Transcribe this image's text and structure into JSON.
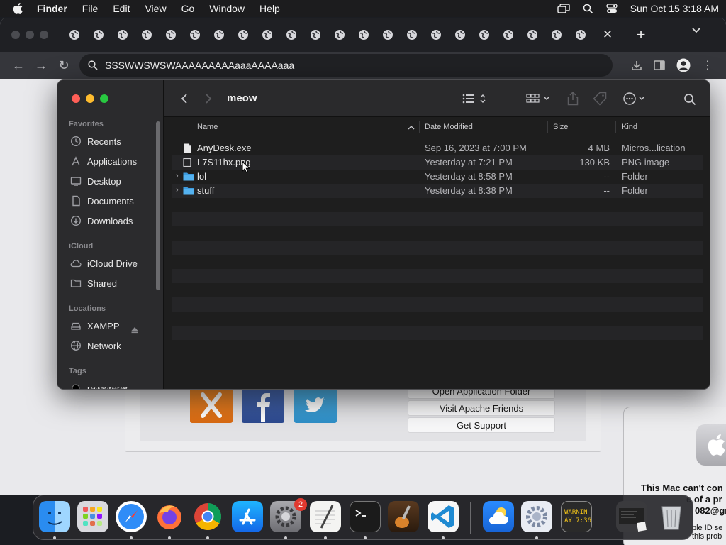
{
  "menubar": {
    "app_name": "Finder",
    "items": [
      "File",
      "Edit",
      "View",
      "Go",
      "Window",
      "Help"
    ],
    "clock": "Sun Oct 15  3:18 AM"
  },
  "browser": {
    "address": "SSSWWSWSWAAAAAAAAAaaaAAAAaaa",
    "tab_count": 22
  },
  "xampp": {
    "buttons": [
      "Open Application Folder",
      "Visit Apache Friends",
      "Get Support"
    ]
  },
  "alert": {
    "line1": "This Mac can't con",
    "line2": "e of a pr",
    "line3": "082@gr",
    "line4": "ple ID se",
    "line5": "this prob"
  },
  "finder": {
    "folder_title": "meow",
    "sidebar": {
      "favorites_label": "Favorites",
      "favorites": [
        {
          "label": "Recents",
          "icon": "clock-icon"
        },
        {
          "label": "Applications",
          "icon": "applications-icon"
        },
        {
          "label": "Desktop",
          "icon": "desktop-icon"
        },
        {
          "label": "Documents",
          "icon": "document-icon"
        },
        {
          "label": "Downloads",
          "icon": "download-icon"
        }
      ],
      "icloud_label": "iCloud",
      "icloud": [
        {
          "label": "iCloud Drive",
          "icon": "cloud-icon"
        },
        {
          "label": "Shared",
          "icon": "shared-folder-icon"
        }
      ],
      "locations_label": "Locations",
      "locations": [
        {
          "label": "XAMPP",
          "icon": "drive-icon"
        },
        {
          "label": "Network",
          "icon": "globe-icon"
        }
      ],
      "tags_label": "Tags",
      "tags": [
        {
          "label": "rewwrerer"
        }
      ]
    },
    "columns": {
      "name": "Name",
      "date": "Date Modified",
      "size": "Size",
      "kind": "Kind"
    },
    "files": [
      {
        "name": "AnyDesk.exe",
        "date": "Sep 16, 2023 at 7:00 PM",
        "size": "4 MB",
        "kind": "Micros...lication",
        "icon": "file-icon"
      },
      {
        "name": "L7S11hx.png",
        "date": "Yesterday at 7:21 PM",
        "size": "130 KB",
        "kind": "PNG image",
        "icon": "image-file-icon"
      },
      {
        "name": "lol",
        "date": "Yesterday at 8:58 PM",
        "size": "--",
        "kind": "Folder",
        "icon": "folder-icon"
      },
      {
        "name": "stuff",
        "date": "Yesterday at 8:38 PM",
        "size": "--",
        "kind": "Folder",
        "icon": "folder-icon"
      }
    ]
  },
  "dock": {
    "settings_badge": "2",
    "console_text_1": "WARNIN",
    "console_text_2": "AY 7:36"
  }
}
